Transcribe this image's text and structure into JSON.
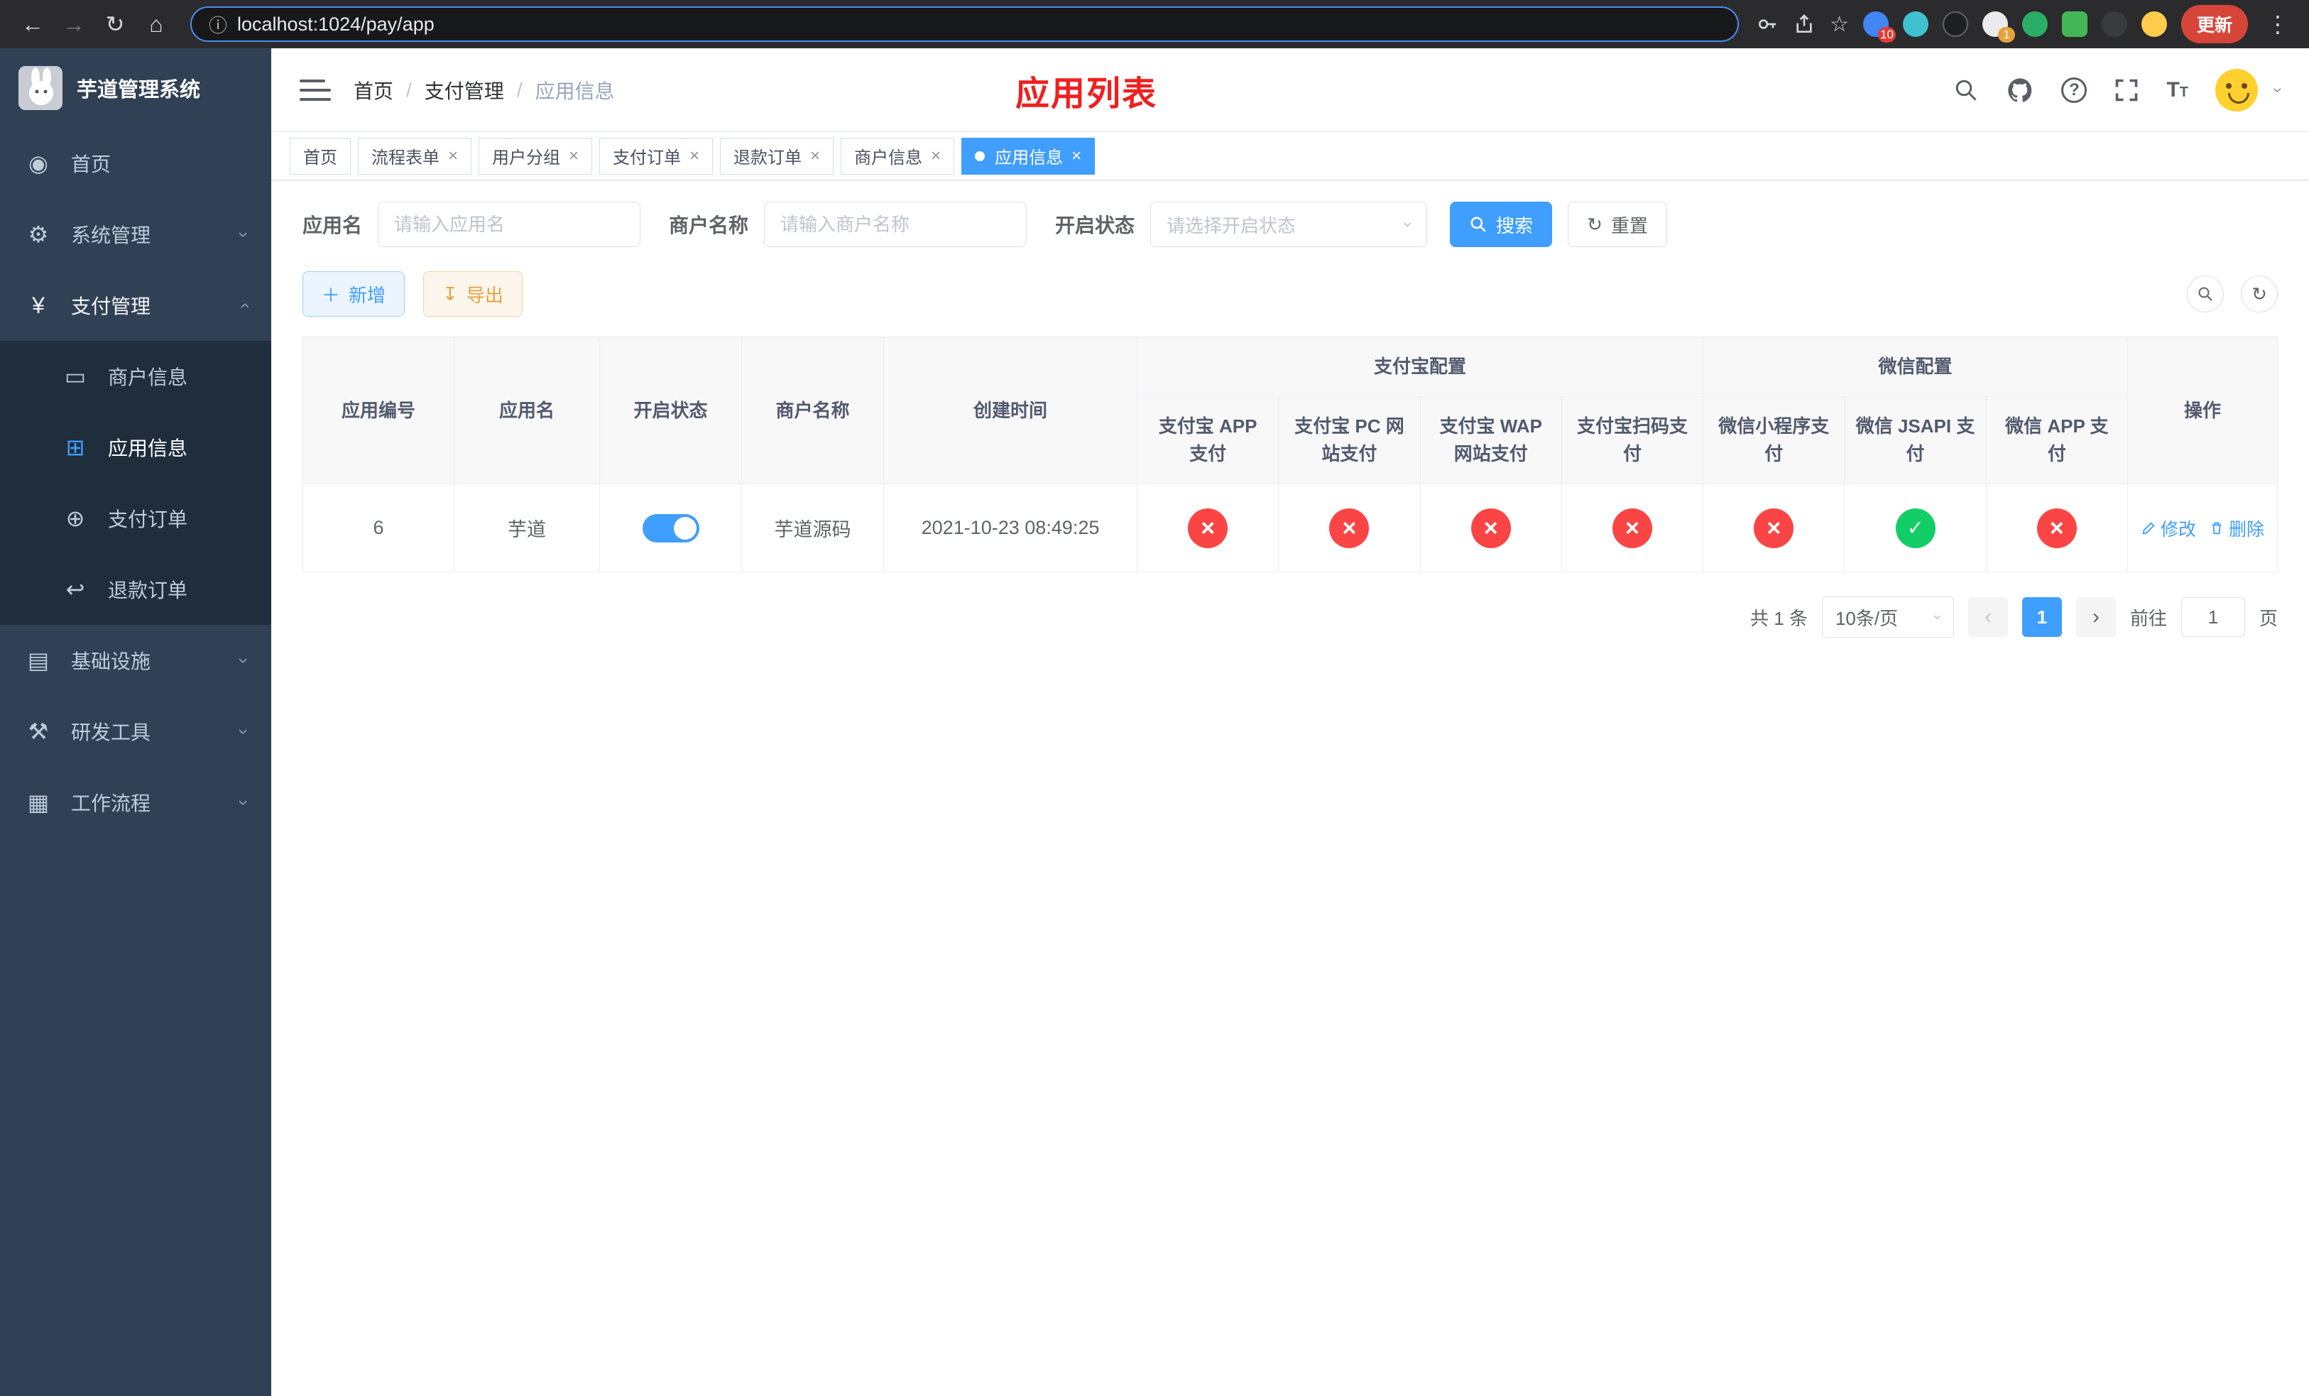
{
  "colors": {
    "accent": "#409eff",
    "danger": "#fb4545",
    "success": "#13ce66",
    "sidebar_bg": "#304156",
    "submenu_bg": "#1f2d3d",
    "annotation_red": "#f01f1f"
  },
  "browser": {
    "url": "localhost:1024/pay/app",
    "update_label": "更新",
    "ext_badge_1": "10",
    "ext_badge_2": "1"
  },
  "sidebar": {
    "title": "芋道管理系统",
    "items": [
      {
        "label": "首页"
      },
      {
        "label": "系统管理"
      },
      {
        "label": "支付管理"
      },
      {
        "label": "基础设施"
      },
      {
        "label": "研发工具"
      },
      {
        "label": "工作流程"
      }
    ],
    "submenu": [
      {
        "label": "商户信息"
      },
      {
        "label": "应用信息"
      },
      {
        "label": "支付订单"
      },
      {
        "label": "退款订单"
      }
    ]
  },
  "navbar": {
    "breadcrumb": [
      "首页",
      "支付管理",
      "应用信息"
    ],
    "annotation": "应用列表"
  },
  "tabs": [
    {
      "label": "首页"
    },
    {
      "label": "流程表单"
    },
    {
      "label": "用户分组"
    },
    {
      "label": "支付订单"
    },
    {
      "label": "退款订单"
    },
    {
      "label": "商户信息"
    },
    {
      "label": "应用信息"
    }
  ],
  "filters": {
    "app_name_label": "应用名",
    "app_name_placeholder": "请输入应用名",
    "merchant_label": "商户名称",
    "merchant_placeholder": "请输入商户名称",
    "status_label": "开启状态",
    "status_placeholder": "请选择开启状态",
    "search_label": "搜索",
    "reset_label": "重置"
  },
  "toolbar": {
    "add_label": "新增",
    "export_label": "导出"
  },
  "table": {
    "headers": {
      "app_id": "应用编号",
      "app_name": "应用名",
      "status": "开启状态",
      "merchant": "商户名称",
      "created": "创建时间",
      "alipay_group": "支付宝配置",
      "wechat_group": "微信配置",
      "actions": "操作",
      "sub": [
        "支付宝 APP 支付",
        "支付宝 PC 网站支付",
        "支付宝 WAP 网站支付",
        "支付宝扫码支付",
        "微信小程序支付",
        "微信 JSAPI 支付",
        "微信 APP 支付"
      ]
    },
    "row": {
      "app_id": "6",
      "app_name": "芋道",
      "status_on": "true",
      "merchant": "芋道源码",
      "created": "2021-10-23 08:49:25",
      "alipay_app": "cross",
      "alipay_pc": "cross",
      "alipay_wap": "cross",
      "alipay_qr": "cross",
      "wx_mini": "cross",
      "wx_jsapi": "check",
      "wx_app": "cross",
      "edit_label": "修改",
      "delete_label": "删除"
    }
  },
  "pagination": {
    "total": "共 1 条",
    "page_size": "10条/页",
    "page": "1",
    "goto_label": "前往",
    "goto_value": "1",
    "page_suffix": "页"
  }
}
